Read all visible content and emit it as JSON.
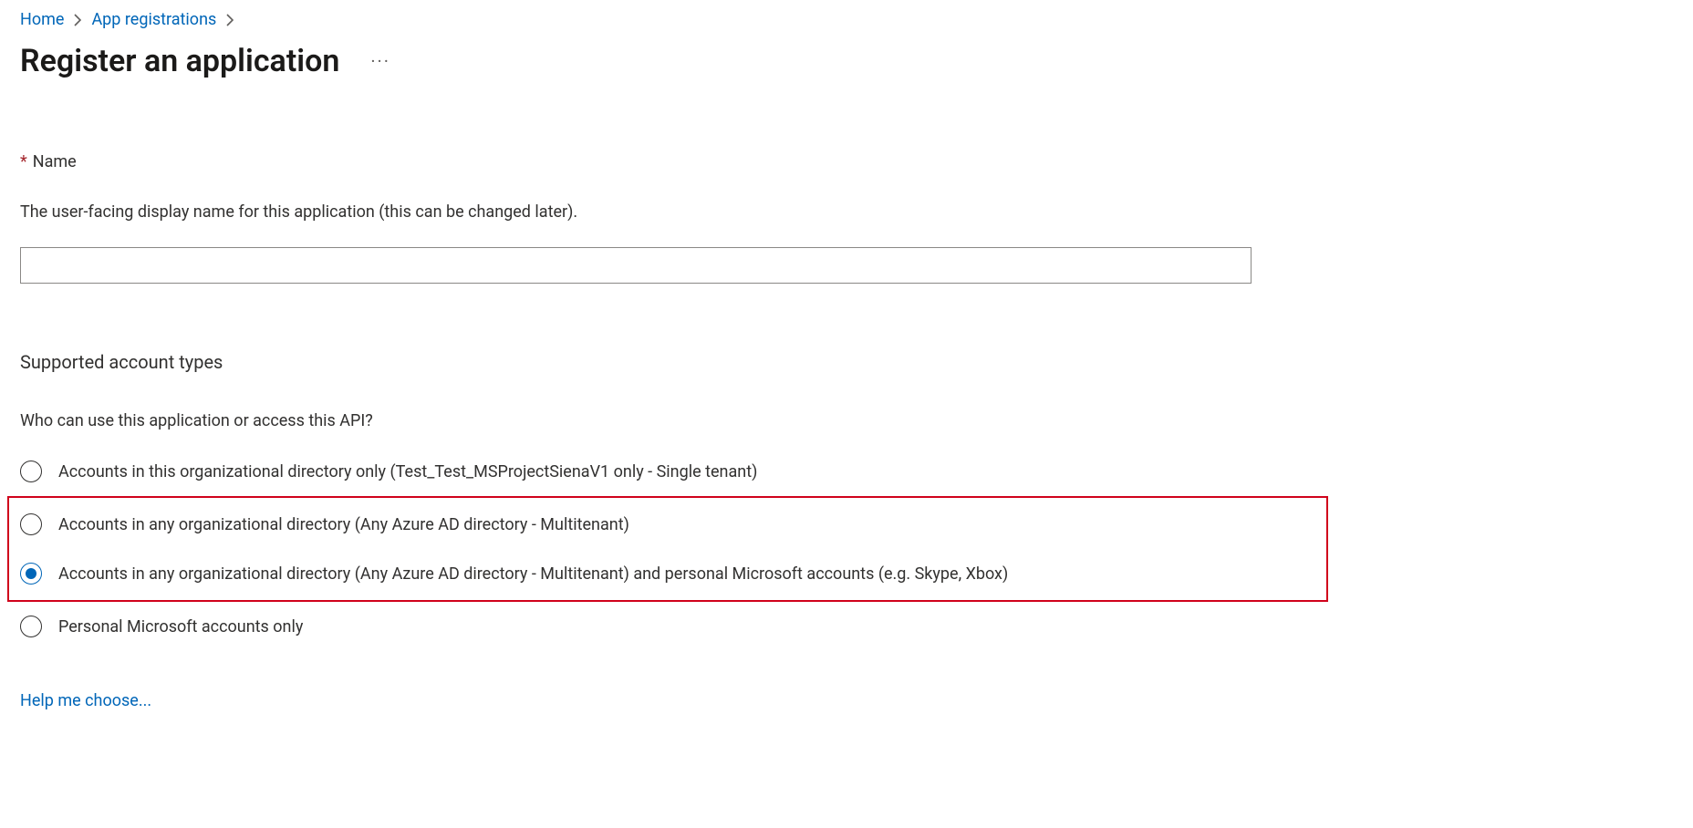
{
  "breadcrumb": {
    "items": [
      {
        "label": "Home"
      },
      {
        "label": "App registrations"
      }
    ]
  },
  "title": "Register an application",
  "name_section": {
    "label": "Name",
    "required_marker": "*",
    "description": "The user-facing display name for this application (this can be changed later).",
    "value": ""
  },
  "account_types_section": {
    "heading": "Supported account types",
    "question": "Who can use this application or access this API?",
    "options": [
      {
        "label": "Accounts in this organizational directory only (Test_Test_MSProjectSienaV1 only - Single tenant)",
        "selected": false,
        "highlighted": false
      },
      {
        "label": "Accounts in any organizational directory (Any Azure AD directory - Multitenant)",
        "selected": false,
        "highlighted": true
      },
      {
        "label": "Accounts in any organizational directory (Any Azure AD directory - Multitenant) and personal Microsoft accounts (e.g. Skype, Xbox)",
        "selected": true,
        "highlighted": true
      },
      {
        "label": "Personal Microsoft accounts only",
        "selected": false,
        "highlighted": false
      }
    ],
    "help_link": "Help me choose..."
  },
  "colors": {
    "link": "#0066b8",
    "text": "#323130",
    "required": "#a4262c",
    "highlight_border": "#d0021b"
  }
}
